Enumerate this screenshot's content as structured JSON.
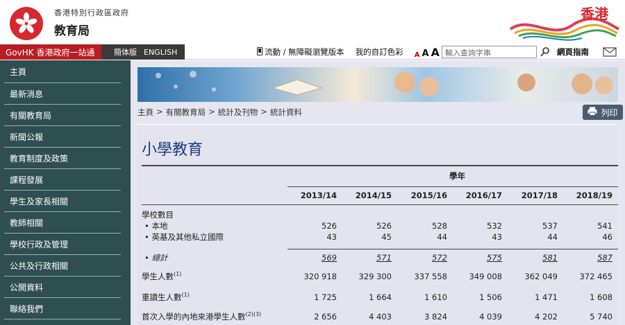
{
  "header": {
    "dept_line1": "香港特別行政區政府",
    "dept_line2": "教育局",
    "brand_text": "香港"
  },
  "topbar": {
    "govhk": "GovHK 香港政府一站通",
    "lang_simplified": "簡体版",
    "lang_english": "ENGLISH",
    "mobile": "流動 / 無障礙瀏覽版本",
    "my_colour": "我的自訂色彩",
    "font_a1": "A",
    "font_a2": "A",
    "font_a3": "A",
    "search_placeholder": "輸入查詢字串",
    "sitemap": "網頁指南"
  },
  "sidebar": {
    "items": [
      {
        "label": "主頁"
      },
      {
        "label": "最新消息"
      },
      {
        "label": "有關教育局"
      },
      {
        "label": "新聞公報"
      },
      {
        "label": "教育制度及政策"
      },
      {
        "label": "課程發展"
      },
      {
        "label": "學生及家長相關"
      },
      {
        "label": "教師相關"
      },
      {
        "label": "學校行政及管理"
      },
      {
        "label": "公共及行政相關"
      },
      {
        "label": "公開資料"
      },
      {
        "label": "聯絡我們"
      }
    ]
  },
  "breadcrumb": {
    "items": [
      "主頁",
      "有關教育局",
      "統計及刊物",
      "統計資料"
    ],
    "separator": ">"
  },
  "print_label": "列印",
  "page_title": "小學教育",
  "table": {
    "group_header": "學年",
    "years": [
      "2013/14",
      "2014/15",
      "2015/16",
      "2016/17",
      "2017/18",
      "2018/19"
    ],
    "section1_title": "學校數目",
    "rows_schools": [
      {
        "label": "本地",
        "values": [
          "526",
          "526",
          "528",
          "532",
          "537",
          "541"
        ]
      },
      {
        "label": "英基及其他私立國際",
        "values": [
          "43",
          "45",
          "44",
          "43",
          "44",
          "46"
        ]
      }
    ],
    "total_label": "總計",
    "total_values": [
      "569",
      "571",
      "572",
      "575",
      "581",
      "587"
    ],
    "rows_other": [
      {
        "label": "學生人數",
        "sup": "(1)",
        "values": [
          "320 918",
          "329 300",
          "337 558",
          "349 008",
          "362 049",
          "372 465"
        ]
      },
      {
        "label": "重讀生人數",
        "sup": "(1)",
        "values": [
          "1 725",
          "1 664",
          "1 610",
          "1 506",
          "1 471",
          "1 608"
        ]
      },
      {
        "label": "首次入學的內地來港學生人數",
        "sup": "(2)(3)",
        "values": [
          "2 656",
          "4 403",
          "3 824",
          "4 039",
          "4 202",
          "5 740"
        ]
      }
    ]
  },
  "colors": {
    "govhk_red": "#b81d23",
    "sidebar_bg": "#2e4e4f",
    "title_blue": "#1a3a7a",
    "content_bg": "#e4e4ee"
  }
}
